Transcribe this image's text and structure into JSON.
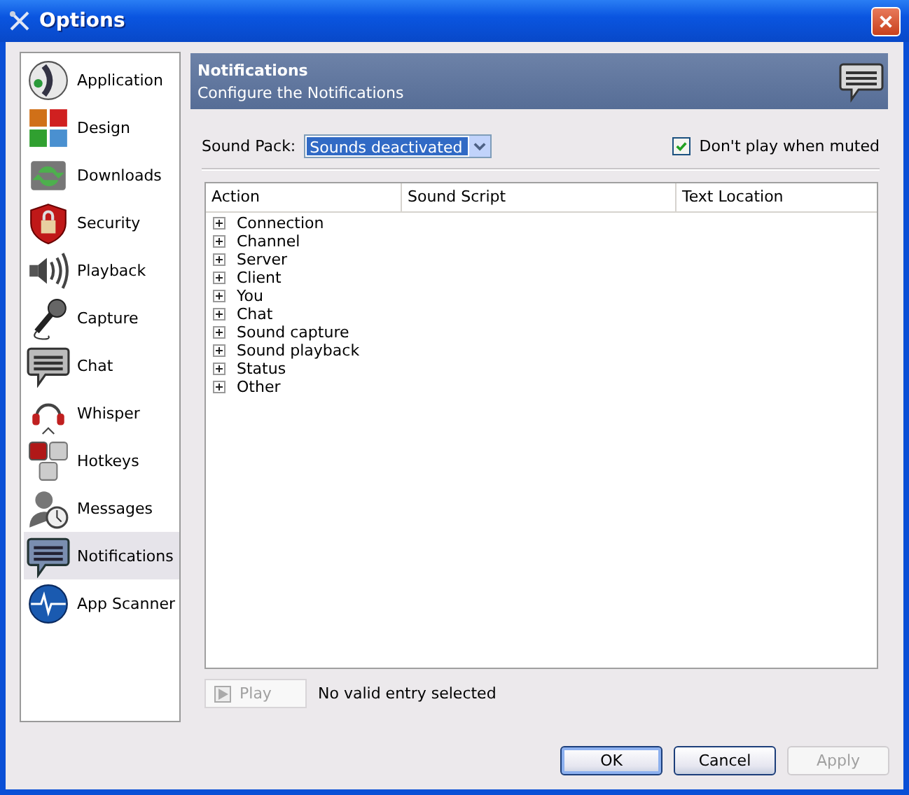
{
  "window": {
    "title": "Options"
  },
  "sidebar": {
    "items": [
      {
        "label": "Application",
        "selected": false
      },
      {
        "label": "Design",
        "selected": false
      },
      {
        "label": "Downloads",
        "selected": false
      },
      {
        "label": "Security",
        "selected": false
      },
      {
        "label": "Playback",
        "selected": false
      },
      {
        "label": "Capture",
        "selected": false
      },
      {
        "label": "Chat",
        "selected": false
      },
      {
        "label": "Whisper",
        "selected": false
      },
      {
        "label": "Hotkeys",
        "selected": false
      },
      {
        "label": "Messages",
        "selected": false
      },
      {
        "label": "Notifications",
        "selected": true
      },
      {
        "label": "App Scanner",
        "selected": false
      }
    ]
  },
  "header": {
    "title": "Notifications",
    "subtitle": "Configure the Notifications"
  },
  "sound_pack": {
    "label": "Sound Pack:",
    "value": "Sounds deactivated"
  },
  "mute_option": {
    "label": "Don't play when muted",
    "checked": true
  },
  "table": {
    "columns": [
      "Action",
      "Sound Script",
      "Text Location"
    ],
    "rows": [
      {
        "label": "Connection",
        "expanded": false
      },
      {
        "label": "Channel",
        "expanded": false
      },
      {
        "label": "Server",
        "expanded": false
      },
      {
        "label": "Client",
        "expanded": false
      },
      {
        "label": "You",
        "expanded": false
      },
      {
        "label": "Chat",
        "expanded": false
      },
      {
        "label": "Sound capture",
        "expanded": false
      },
      {
        "label": "Sound playback",
        "expanded": false
      },
      {
        "label": "Status",
        "expanded": false
      },
      {
        "label": "Other",
        "expanded": false
      }
    ]
  },
  "play_button": {
    "label": "Play",
    "disabled": true
  },
  "play_status": "No valid entry selected",
  "buttons": [
    {
      "label": "OK",
      "disabled": false,
      "default": true
    },
    {
      "label": "Cancel",
      "disabled": false,
      "default": false
    },
    {
      "label": "Apply",
      "disabled": true,
      "default": false
    }
  ]
}
